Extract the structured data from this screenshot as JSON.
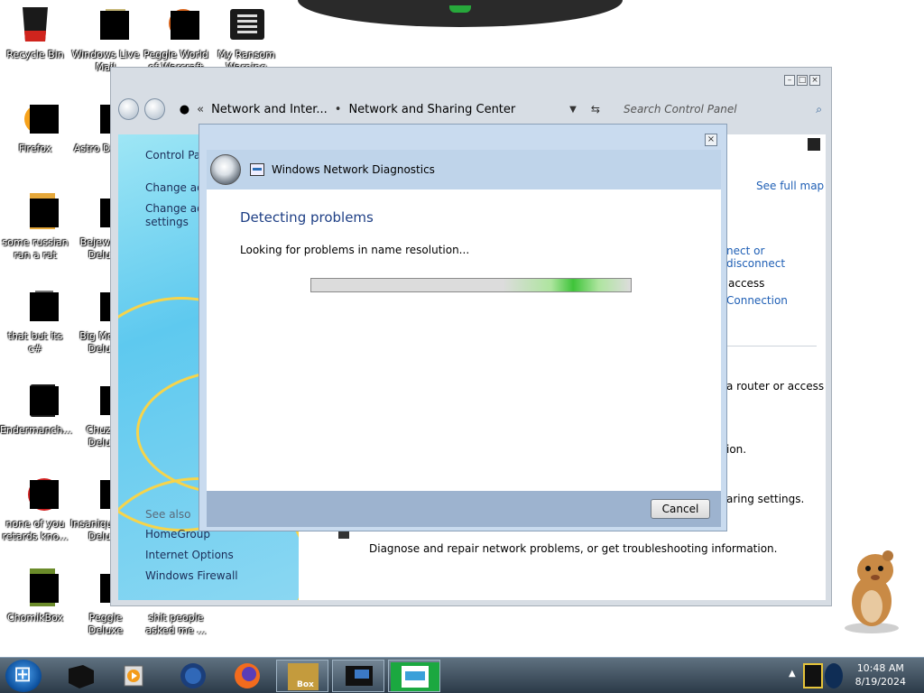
{
  "desktop": {
    "icons": [
      {
        "label": "Recycle Bin"
      },
      {
        "label": "Windows Live Mail"
      },
      {
        "label": "Peggle World of Warcraft"
      },
      {
        "label": "My Ransom Warning Screen"
      },
      {
        "label": "Firefox"
      },
      {
        "label": "Astro Deluxe"
      },
      {
        "label": "some russian ran a rat"
      },
      {
        "label": "Bejeweled Deluxe"
      },
      {
        "label": "that but its c#"
      },
      {
        "label": "Big Money Deluxe"
      },
      {
        "label": "Endermanch..."
      },
      {
        "label": "Chuzzle Deluxe"
      },
      {
        "label": "none of you retards kno..."
      },
      {
        "label": "Insaniquarium Deluxe"
      },
      {
        "label": "ChomikBox"
      },
      {
        "label": "Peggle Deluxe"
      },
      {
        "label": "shit people asked me ..."
      }
    ]
  },
  "control_panel": {
    "breadcrumb_1": "Network and Inter...",
    "breadcrumb_2": "Network and Sharing Center",
    "search_placeholder": "Search Control Panel",
    "sidebar": {
      "items": [
        {
          "label": "Control Panel Home"
        },
        {
          "label": "Change adapter settings"
        },
        {
          "label": "Change advanced sharing settings"
        }
      ],
      "see_also": "See also",
      "links": [
        {
          "label": "HomeGroup"
        },
        {
          "label": "Internet Options"
        },
        {
          "label": "Windows Firewall"
        }
      ]
    },
    "main": {
      "see_full_map": "See full map",
      "connect_disconnect": "nect or disconnect",
      "access": "access",
      "connection": "Connection",
      "router_text": "a router or access",
      "ion_text": "ion.",
      "sharing_text": "aring settings.",
      "diagnose_text": "Diagnose and repair network problems, or get troubleshooting information."
    }
  },
  "dialog": {
    "title": "Windows Network Diagnostics",
    "heading": "Detecting problems",
    "message": "Looking for problems in name resolution...",
    "progress_fraction": 1.0,
    "cancel_label": "Cancel"
  },
  "taskbar": {
    "time": "10:48 AM",
    "date": "8/19/2024",
    "box_label": "Box"
  }
}
